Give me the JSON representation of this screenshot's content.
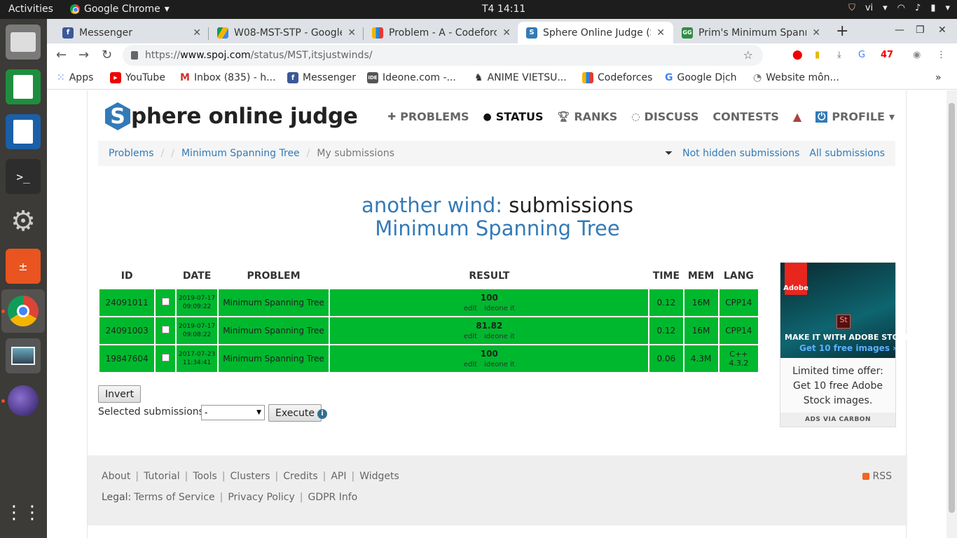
{
  "os": {
    "activities": "Activities",
    "app_name": "Google Chrome",
    "clock": "T4 14:11",
    "lang": "vi"
  },
  "tabs": [
    {
      "title": "Messenger"
    },
    {
      "title": "W08-MST-STP - Google"
    },
    {
      "title": "Problem - A - Codeforces"
    },
    {
      "title": "Sphere Online Judge (S"
    },
    {
      "title": "Prim's Minimum Spann"
    }
  ],
  "address": {
    "scheme": "https://",
    "host": "www.spoj.com",
    "path": "/status/MST,itsjustwinds/"
  },
  "extensions": {
    "badge": "47"
  },
  "bookmarks": [
    {
      "label": "Apps"
    },
    {
      "label": "YouTube"
    },
    {
      "label": "Inbox (835) - h..."
    },
    {
      "label": "Messenger"
    },
    {
      "label": "Ideone.com -..."
    },
    {
      "label": "ANIME VIETSU..."
    },
    {
      "label": "Codeforces"
    },
    {
      "label": "Google Dịch"
    },
    {
      "label": "Website môn..."
    }
  ],
  "site": {
    "logo_letter": "S",
    "logo_text": "phere online judge",
    "nav": [
      {
        "label": "PROBLEMS"
      },
      {
        "label": "STATUS"
      },
      {
        "label": "RANKS"
      },
      {
        "label": "DISCUSS"
      },
      {
        "label": "CONTESTS"
      },
      {
        "label": "PROFILE"
      }
    ],
    "breadcrumb": {
      "problems": "Problems",
      "problem": "Minimum Spanning Tree",
      "current": "My submissions",
      "not_hidden": "Not hidden submissions",
      "all": "All submissions"
    },
    "heading": {
      "user": "another wind:",
      "word": "submissions",
      "problem": "Minimum Spanning Tree"
    },
    "table": {
      "headers": [
        "ID",
        "DATE",
        "PROBLEM",
        "RESULT",
        "TIME",
        "MEM",
        "LANG"
      ],
      "rows": [
        {
          "id": "24091011",
          "date": "2019-07-17",
          "time_of_day": "09:09:22",
          "problem": "Minimum Spanning Tree",
          "result": "100",
          "edit": "edit",
          "ideone": "ideone it",
          "time": "0.12",
          "mem": "16M",
          "lang": "CPP14"
        },
        {
          "id": "24091003",
          "date": "2019-07-17",
          "time_of_day": "09:08:22",
          "problem": "Minimum Spanning Tree",
          "result": "81.82",
          "edit": "edit",
          "ideone": "ideone it",
          "time": "0.12",
          "mem": "16M",
          "lang": "CPP14"
        },
        {
          "id": "19847604",
          "date": "2017-07-23",
          "time_of_day": "11:34:41",
          "problem": "Minimum Spanning Tree",
          "result": "100",
          "edit": "edit",
          "ideone": "ideone it",
          "time": "0.06",
          "mem": "4.3M",
          "lang": "C++ 4.3.2"
        }
      ],
      "accepted_color": "#00b82e"
    },
    "controls": {
      "invert": "Invert",
      "selected_label": "Selected submissions:",
      "selected_value": "-",
      "execute": "Execute"
    },
    "ad": {
      "brand": "Adobe",
      "icon": "St",
      "tagline": "MAKE IT WITH ADOBE STOCK",
      "cta": "Get 10 free images ›",
      "text": "Limited time offer: Get 10 free Adobe Stock images.",
      "via": "ADS VIA CARBON"
    },
    "footer": {
      "row1": [
        "About",
        "Tutorial",
        "Tools",
        "Clusters",
        "Credits",
        "API",
        "Widgets"
      ],
      "legal": "Legal:",
      "row2": [
        "Terms of Service",
        "Privacy Policy",
        "GDPR Info"
      ],
      "rss": "RSS"
    }
  }
}
